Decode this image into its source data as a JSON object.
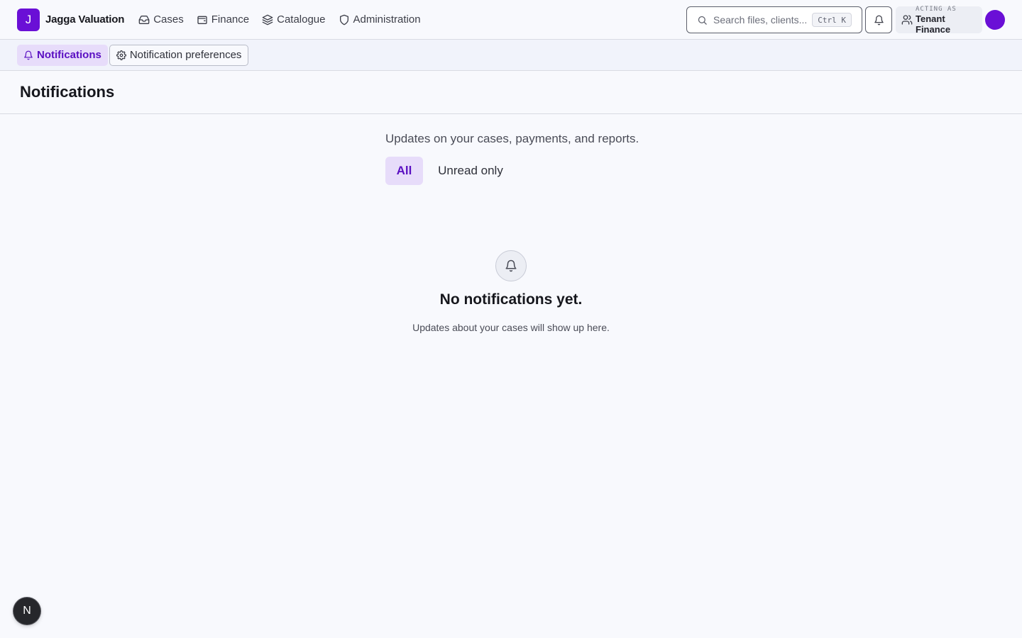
{
  "brand": {
    "logo_letter": "J",
    "name": "Jagga Valuation"
  },
  "nav": {
    "items": [
      {
        "label": "Cases",
        "icon": "inbox-icon"
      },
      {
        "label": "Finance",
        "icon": "wallet-icon"
      },
      {
        "label": "Catalogue",
        "icon": "layers-icon"
      },
      {
        "label": "Administration",
        "icon": "shield-icon"
      }
    ]
  },
  "search": {
    "placeholder": "Search files, clients...",
    "shortcut": "Ctrl K"
  },
  "acting": {
    "label": "ACTING AS",
    "name": "Tenant Finance"
  },
  "subnav": {
    "notifications": "Notifications",
    "preferences": "Notification preferences"
  },
  "page": {
    "title": "Notifications",
    "subtitle": "Updates on your cases, payments, and reports."
  },
  "filters": {
    "all": "All",
    "unread": "Unread only"
  },
  "empty": {
    "title": "No notifications yet.",
    "description": "Updates about your cases will show up here."
  },
  "dev_badge": "N",
  "colors": {
    "accent": "#6a0fd6",
    "accent_soft": "#e7dcfa",
    "background": "#f8f9fd"
  }
}
